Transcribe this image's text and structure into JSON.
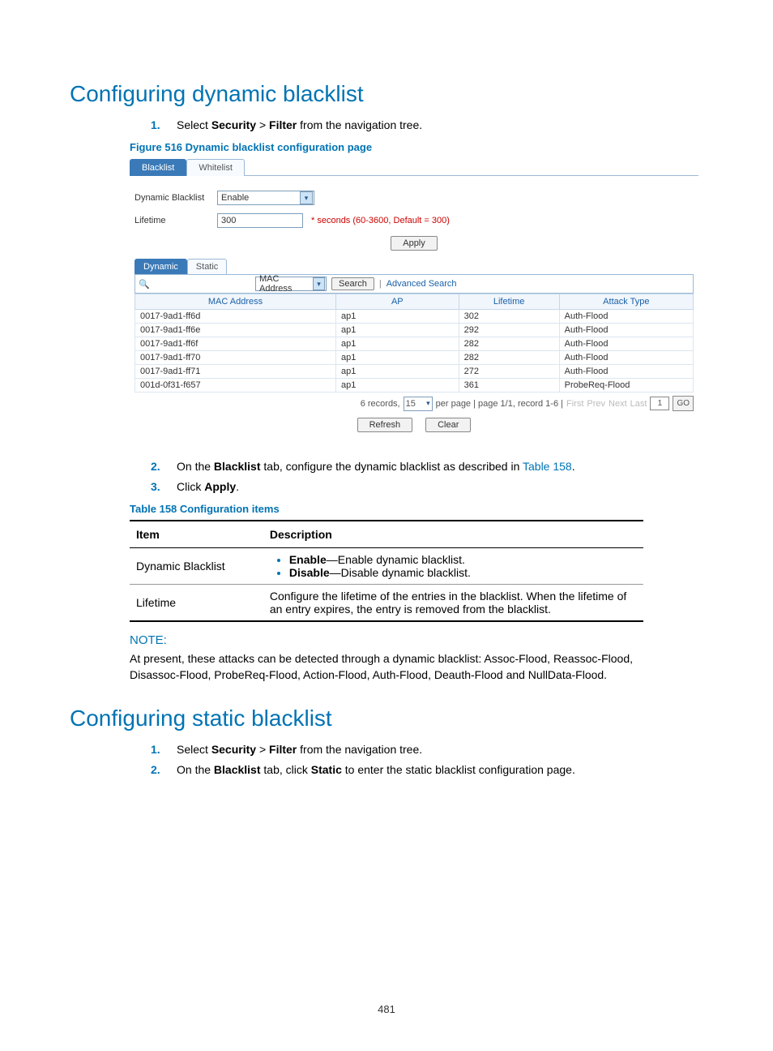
{
  "h1_dynamic": "Configuring dynamic blacklist",
  "h1_static": "Configuring static blacklist",
  "steps_dynamic": {
    "n1": "1.",
    "s1a": "Select ",
    "s1b": "Security",
    "s1c": " > ",
    "s1d": "Filter",
    "s1e": " from the navigation tree.",
    "n2": "2.",
    "s2a": "On the ",
    "s2b": "Blacklist",
    "s2c": " tab, configure the dynamic blacklist as described in ",
    "s2d": "Table 158",
    "s2e": ".",
    "n3": "3.",
    "s3a": "Click ",
    "s3b": "Apply",
    "s3c": "."
  },
  "figure_caption": "Figure 516 Dynamic blacklist configuration page",
  "table_caption": "Table 158 Configuration items",
  "shot": {
    "tab_blacklist": "Blacklist",
    "tab_whitelist": "Whitelist",
    "lbl_dynamic": "Dynamic Blacklist",
    "sel_enable": "Enable",
    "lbl_lifetime": "Lifetime",
    "val_lifetime": "300",
    "hint_lifetime": "* seconds (60-3600, Default = 300)",
    "btn_apply": "Apply",
    "subtab_dynamic": "Dynamic",
    "subtab_static": "Static",
    "sel_mac": "MAC Address",
    "btn_search": "Search",
    "link_adv": "Advanced Search",
    "col_mac": "MAC Address",
    "col_ap": "AP",
    "col_life": "Lifetime",
    "col_attack": "Attack Type",
    "rows": [
      {
        "mac": "0017-9ad1-ff6d",
        "ap": "ap1",
        "life": "302",
        "atk": "Auth-Flood"
      },
      {
        "mac": "0017-9ad1-ff6e",
        "ap": "ap1",
        "life": "292",
        "atk": "Auth-Flood"
      },
      {
        "mac": "0017-9ad1-ff6f",
        "ap": "ap1",
        "life": "282",
        "atk": "Auth-Flood"
      },
      {
        "mac": "0017-9ad1-ff70",
        "ap": "ap1",
        "life": "282",
        "atk": "Auth-Flood"
      },
      {
        "mac": "0017-9ad1-ff71",
        "ap": "ap1",
        "life": "272",
        "atk": "Auth-Flood"
      },
      {
        "mac": "001d-0f31-f657",
        "ap": "ap1",
        "life": "361",
        "atk": "ProbeReq-Flood"
      }
    ],
    "pager_records": "6 records,",
    "pager_perpage": "15",
    "pager_mid": "per page | page 1/1, record 1-6 |",
    "pager_first": "First",
    "pager_prev": "Prev",
    "pager_next": "Next",
    "pager_last": "Last",
    "pager_gobox": "1",
    "pager_go": "GO",
    "btn_refresh": "Refresh",
    "btn_clear": "Clear"
  },
  "cfg": {
    "th_item": "Item",
    "th_desc": "Description",
    "r1_item": "Dynamic Blacklist",
    "r1_b1a": "Enable",
    "r1_b1b": "—Enable dynamic blacklist.",
    "r1_b2a": "Disable",
    "r1_b2b": "—Disable dynamic blacklist.",
    "r2_item": "Lifetime",
    "r2_desc": "Configure the lifetime of the entries in the blacklist. When the lifetime of an entry expires, the entry is removed from the blacklist."
  },
  "note_label": "NOTE:",
  "note_body": "At present, these attacks can be detected through a dynamic blacklist: Assoc-Flood, Reassoc-Flood, Disassoc-Flood, ProbeReq-Flood, Action-Flood, Auth-Flood, Deauth-Flood and NullData-Flood.",
  "steps_static": {
    "n1": "1.",
    "s1a": "Select ",
    "s1b": "Security",
    "s1c": " > ",
    "s1d": "Filter",
    "s1e": " from the navigation tree.",
    "n2": "2.",
    "s2a": "On the ",
    "s2b": "Blacklist",
    "s2c": " tab, click ",
    "s2d": "Static",
    "s2e": " to enter the static blacklist configuration page."
  },
  "page_number": "481"
}
